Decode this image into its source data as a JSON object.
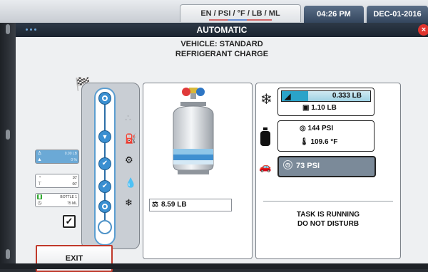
{
  "statusbar": {
    "units": "EN / PSI / °F / LB / ML",
    "time": "04:26 PM",
    "date": "DEC-01-2016"
  },
  "window": {
    "title": "AUTOMATIC"
  },
  "header": {
    "vehicle": "VEHICLE: STANDARD",
    "subtitle": "REFRIGERANT CHARGE"
  },
  "side_cards": {
    "card1": {
      "r1": "0.00 LB",
      "r2": "0 %"
    },
    "card2": {
      "r1": "10'",
      "r2": "00'"
    },
    "card3": {
      "r1": "BOTTLE 1",
      "r2": "75 ML"
    }
  },
  "tank": {
    "weight": "8.59 LB"
  },
  "charge": {
    "amount": "0.333 LB",
    "target": "1.10 LB",
    "progress_fraction": 0.3
  },
  "tank_pressure": {
    "pressure": "144 PSI",
    "temperature": "109.6 °F"
  },
  "vehicle_pressure": {
    "pressure": "73 PSI"
  },
  "task": {
    "line1": "TASK IS RUNNING",
    "line2": "DO NOT DISTURB"
  },
  "exit": {
    "label": "EXIT"
  },
  "icons": {
    "flag": "checkered-flag-icon",
    "snow": "snowflake-icon",
    "car": "car-icon",
    "oil": "oil-drop-icon",
    "vacuum": "vacuum-pump-icon",
    "tank": "tank-icon"
  },
  "colors": {
    "accent": "#3a8fd1",
    "progress": "#2aa3c9",
    "exit_border": "#c0392b",
    "titlebar": "#1b2430"
  }
}
